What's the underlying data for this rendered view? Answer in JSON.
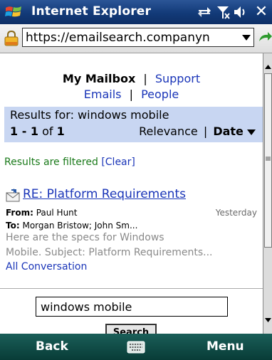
{
  "titlebar": {
    "title": "Internet Explorer",
    "icons": [
      "windows-logo-icon",
      "connectivity-icon",
      "signal-off-icon",
      "volume-icon",
      "close-icon"
    ],
    "close_label": "✕"
  },
  "addressbar": {
    "url": "https://emailsearch.companyn"
  },
  "nav": {
    "my_mailbox": "My Mailbox",
    "sep1": "|",
    "support": "Support",
    "emails": "Emails",
    "sep2": "|",
    "people": "People"
  },
  "results": {
    "results_for": "Results for: windows mobile",
    "range_bold": "1 - 1",
    "range_of": "of",
    "range_total": "1",
    "sort_relevance": "Relevance",
    "sort_sep": "|",
    "sort_date": "Date"
  },
  "filter": {
    "text": "Results are filtered",
    "clear_link": "[Clear]"
  },
  "message": {
    "subject": "RE: Platform Requirements",
    "from_label": "From:",
    "from_value": "Paul Hunt",
    "date": "Yesterday",
    "to_label": "To:",
    "to_value": "Morgan Bristow; John Sm...",
    "preview_line1": "Here are the specs for Windows",
    "preview_line2": "Mobile. Subject: Platform Requirements...",
    "all_conversation": "All Conversation"
  },
  "search": {
    "value": "windows mobile",
    "button_label": "Search"
  },
  "softkeys": {
    "left": "Back",
    "right": "Menu"
  },
  "colors": {
    "titlebar": "#123a78",
    "link": "#1a35b8",
    "results_bg": "#c8d6f2",
    "filter_text": "#1a7a1a",
    "bottombar": "#0c4a44"
  }
}
